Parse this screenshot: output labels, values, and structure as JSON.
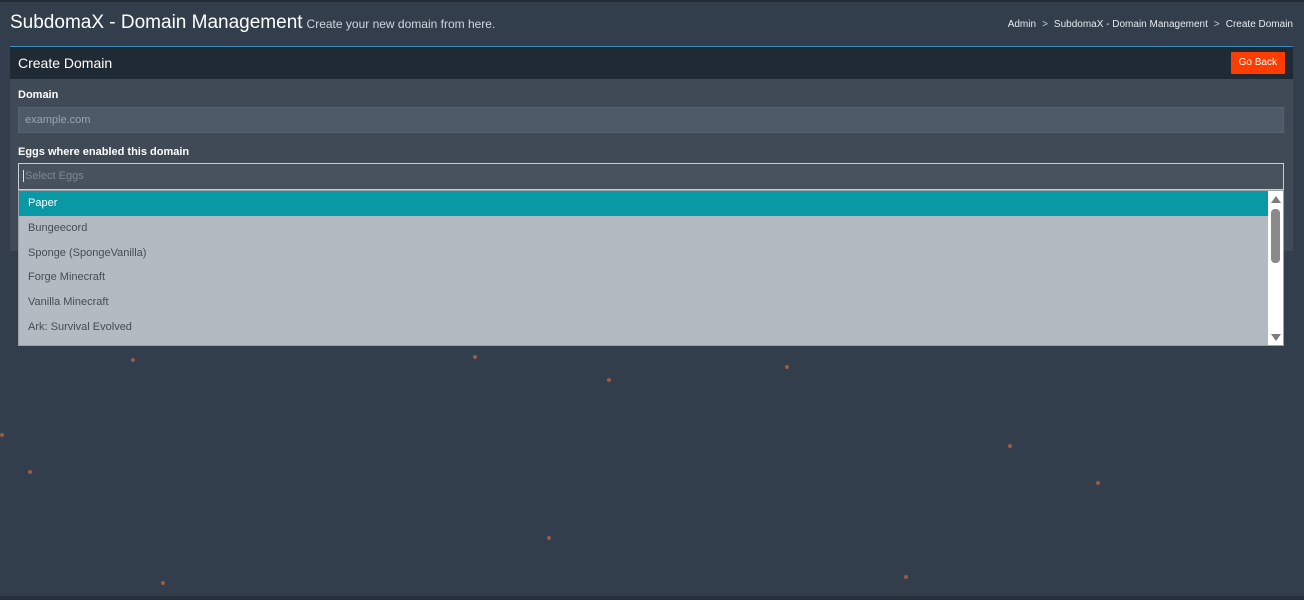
{
  "header": {
    "title": "SubdomaX - Domain Management",
    "subtitle": "Create your new domain from here."
  },
  "breadcrumb": [
    "Admin",
    "SubdomaX - Domain Management",
    "Create Domain"
  ],
  "box": {
    "title": "Create Domain",
    "go_back_label": "Go Back"
  },
  "form": {
    "domain_label": "Domain",
    "domain_placeholder": "example.com",
    "eggs_label": "Eggs where enabled this domain",
    "eggs_placeholder": "Select Eggs"
  },
  "dropdown": {
    "options": [
      "Paper",
      "Bungeecord",
      "Sponge (SpongeVanilla)",
      "Forge Minecraft",
      "Vanilla Minecraft",
      "Ark: Survival Evolved"
    ],
    "selected": "Paper"
  },
  "colors": {
    "background": "#323e4c",
    "accent": "#0899a5",
    "go_back": "#ff3d00"
  }
}
